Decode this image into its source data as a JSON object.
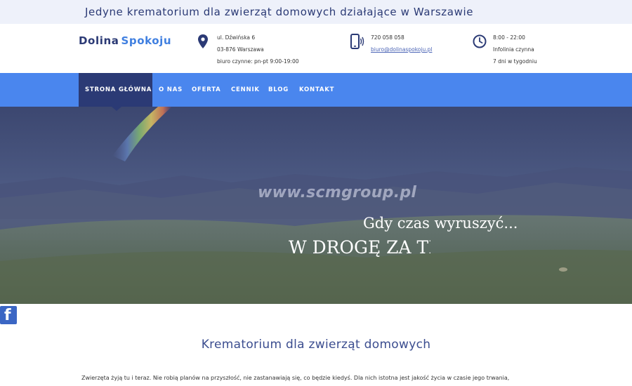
{
  "top_banner": {
    "text": "Jedyne krematorium dla zwierząt domowych działające w Warszawie"
  },
  "logo": {
    "part1": "Dolina",
    "part2": "Spokoju"
  },
  "contact": {
    "address": {
      "icon": "map-pin-icon",
      "line1": "ul. Dźwińska 6",
      "line2": "03-876 Warszawa",
      "line3": "biuro czynne: pn-pt 9:00-19:00"
    },
    "phone": {
      "icon": "phone-icon",
      "number": "720 058 058",
      "email": "biuro@dolinaspokoju.pl"
    },
    "hours": {
      "icon": "clock-icon",
      "line1": "8:00 - 22:00",
      "line2": "Infolinia czynna",
      "line3": "7 dni w tygodniu"
    }
  },
  "nav": {
    "items": [
      {
        "label": "STRONA GŁÓWNA"
      },
      {
        "label": "O NAS"
      },
      {
        "label": "OFERTA"
      },
      {
        "label": "CENNIK"
      },
      {
        "label": "BLOG"
      },
      {
        "label": "KONTAKT"
      }
    ],
    "active_index": 0
  },
  "hero": {
    "watermark": "www.scmgroup.pl",
    "subtitle": "Gdy czas wyruszyć...",
    "title": "W DROGĘ ZA TĘCZĘ"
  },
  "social": {
    "facebook_icon": "facebook-icon",
    "facebook_label": "f"
  },
  "content": {
    "section_title": "Krematorium dla zwierząt domowych",
    "paragraph": "Zwierzęta żyją tu i teraz. Nie robią planów na przyszłość, nie zastanawiają się, co będzie kiedyś. Dla nich istotna jest jakość życia w czasie jego trwania,"
  },
  "colors": {
    "navy": "#2b3a75",
    "nav_blue": "#4a86ee",
    "logo_accent": "#3f7fe0",
    "banner_bg": "#eef1fa",
    "facebook": "#3b66c4"
  }
}
